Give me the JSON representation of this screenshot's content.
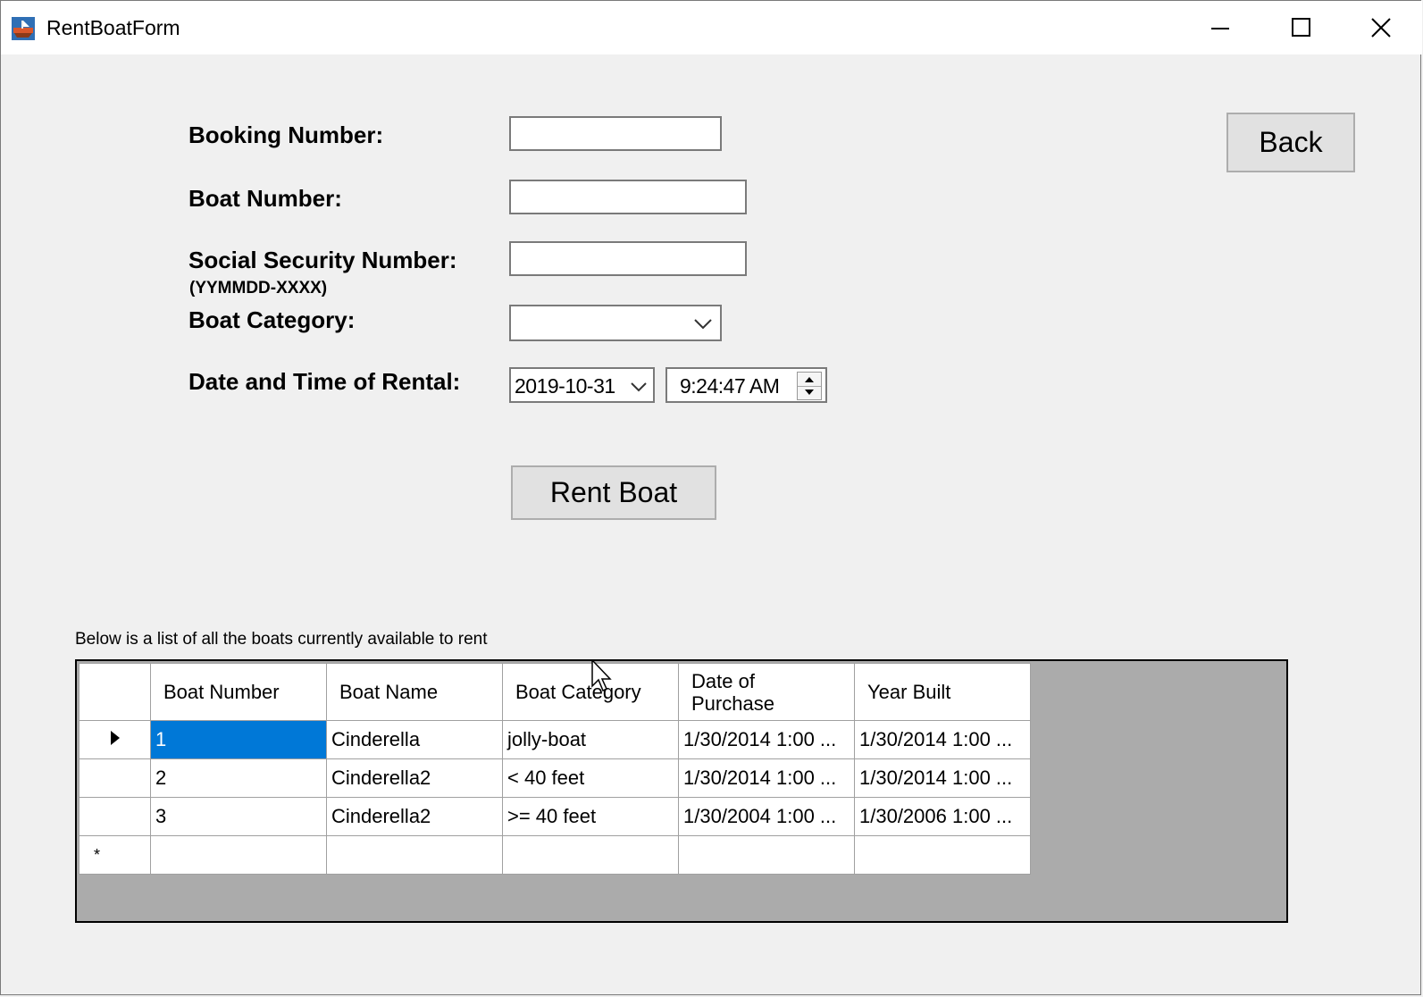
{
  "window": {
    "title": "RentBoatForm"
  },
  "form": {
    "booking_number_label": "Booking Number:",
    "booking_number_value": "",
    "boat_number_label": "Boat Number:",
    "boat_number_value": "",
    "ssn_label": "Social Security Number:",
    "ssn_format_hint": "(YYMMDD-XXXX)",
    "ssn_value": "",
    "boat_category_label": "Boat Category:",
    "boat_category_value": "",
    "date_time_label": "Date and Time of Rental:",
    "rental_date": "2019-10-31",
    "rental_time": "9:24:47 AM",
    "rent_button": "Rent Boat",
    "back_button": "Back"
  },
  "grid": {
    "caption": "Below is a list of all the boats currently available to rent",
    "columns": [
      "Boat Number",
      "Boat Name",
      "Boat Category",
      "Date of\nPurchase",
      "Year Built"
    ],
    "rows": [
      [
        "1",
        "Cinderella",
        "jolly-boat",
        "1/30/2014 1:00 ...",
        "1/30/2014 1:00 ..."
      ],
      [
        "2",
        "Cinderella2",
        "< 40 feet",
        "1/30/2014 1:00 ...",
        "1/30/2014 1:00 ..."
      ],
      [
        "3",
        "Cinderella2",
        ">= 40 feet",
        "1/30/2004 1:00 ...",
        "1/30/2006 1:00 ..."
      ]
    ],
    "selected_row": 0,
    "new_row_marker": "*"
  },
  "colors": {
    "selection": "#0078d7",
    "form_background": "#f0f0f0",
    "grid_background": "#ababab"
  }
}
